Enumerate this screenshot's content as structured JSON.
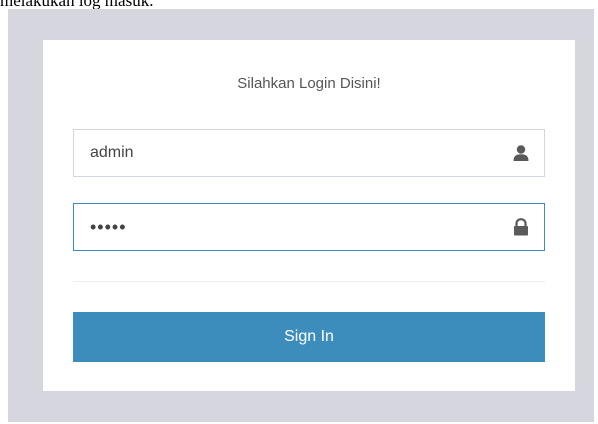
{
  "caption": "melakukan log masuk.",
  "login": {
    "title": "Silahkan Login Disini!",
    "username": {
      "value": "admin",
      "icon": "user-icon"
    },
    "password": {
      "value": "admin",
      "icon": "lock-icon"
    },
    "signin_label": "Sign In"
  },
  "colors": {
    "backdrop": "#d5d6de",
    "accent": "#3c8dbc",
    "field_border": "#d2d6de"
  }
}
